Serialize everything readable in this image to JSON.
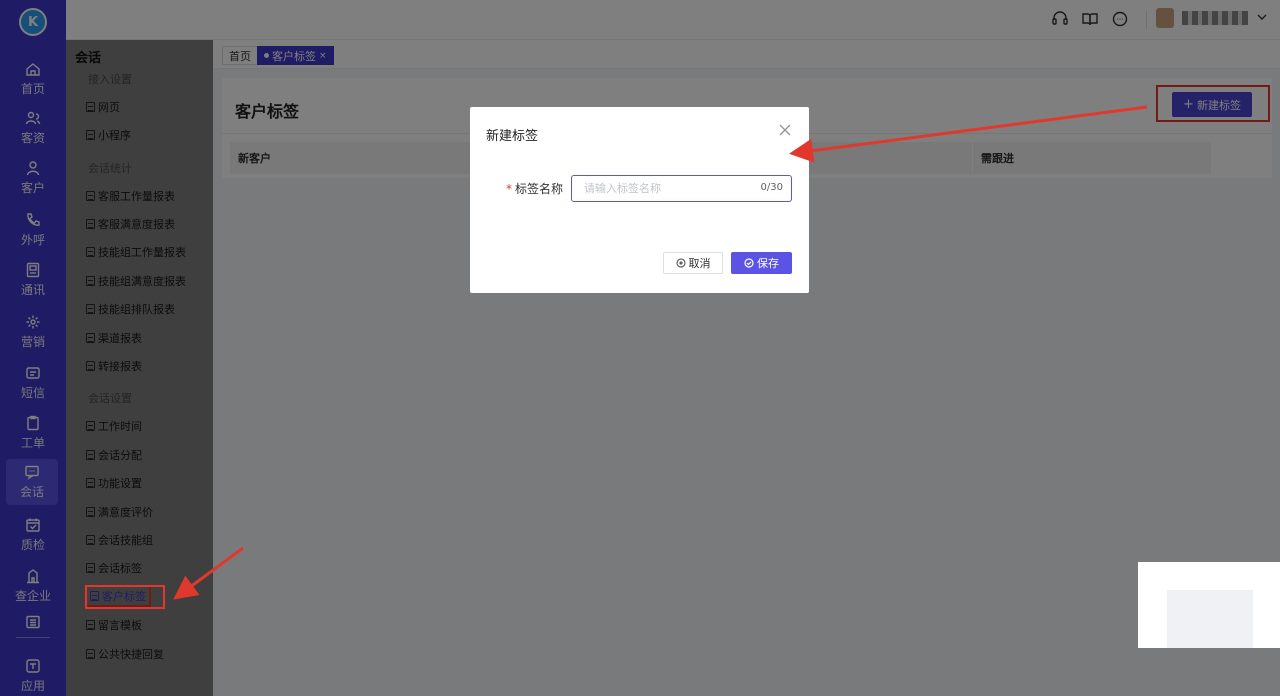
{
  "rail": {
    "logo": "K",
    "items": [
      {
        "label": "首页",
        "icon": "home-icon"
      },
      {
        "label": "客资",
        "icon": "users-icon"
      },
      {
        "label": "客户",
        "icon": "user-icon"
      },
      {
        "label": "外呼",
        "icon": "phone-icon"
      },
      {
        "label": "通讯",
        "icon": "contacts-icon"
      },
      {
        "label": "营销",
        "icon": "marketing-icon"
      },
      {
        "label": "短信",
        "icon": "sms-icon"
      },
      {
        "label": "工单",
        "icon": "clipboard-icon"
      },
      {
        "label": "会话",
        "icon": "chat-icon"
      },
      {
        "label": "质检",
        "icon": "calendar-check-icon"
      },
      {
        "label": "查企业",
        "icon": "building-icon"
      },
      {
        "label": "",
        "icon": "list-icon"
      },
      {
        "label": "应用",
        "icon": "apps-icon"
      }
    ]
  },
  "topbar": {
    "icons": [
      "headset-icon",
      "book-icon",
      "message-icon"
    ]
  },
  "sidebar": {
    "title": "会话",
    "groups": [
      {
        "label": "接入设置",
        "items": [
          "网页",
          "小程序"
        ]
      },
      {
        "label": "会话统计",
        "items": [
          "客服工作量报表",
          "客服满意度报表",
          "技能组工作量报表",
          "技能组满意度报表",
          "技能组排队报表",
          "渠道报表",
          "转接报表"
        ]
      },
      {
        "label": "会话设置",
        "items": [
          "工作时间",
          "会话分配",
          "功能设置",
          "满意度评价",
          "会话技能组",
          "会话标签",
          "客户标签",
          "留言模板",
          "公共快捷回复"
        ]
      }
    ],
    "selected": "客户标签"
  },
  "tabs": {
    "home": "首页",
    "current": "客户标签"
  },
  "main": {
    "title": "客户标签",
    "new_button": "新建标签",
    "columns": [
      "新客户",
      "需跟进"
    ]
  },
  "dialog": {
    "title": "新建标签",
    "field_label": "标签名称",
    "placeholder": "请输入标签名称",
    "value": "",
    "counter": "0/30",
    "cancel": "取消",
    "save": "保存"
  },
  "colors": {
    "primary": "#3f36c8",
    "button": "#5b53e4",
    "annotation": "#e0382c"
  }
}
